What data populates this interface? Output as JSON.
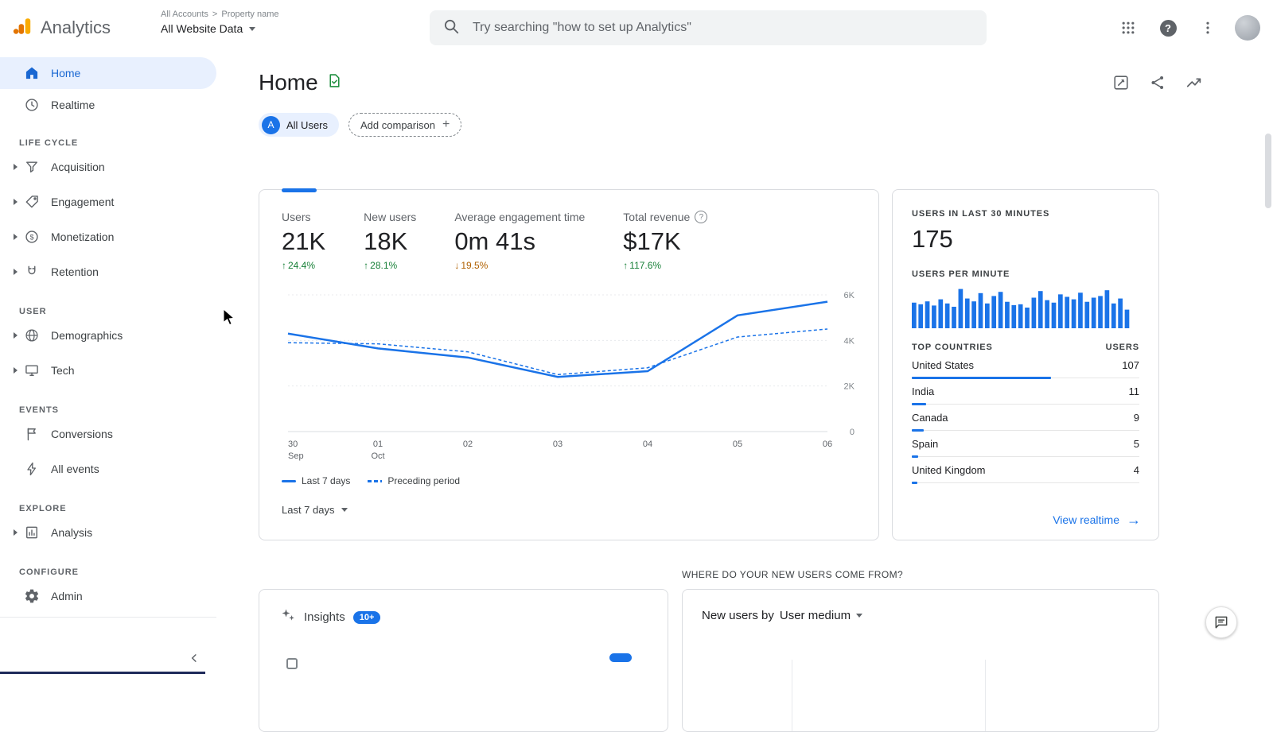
{
  "colors": {
    "accent_blue": "#1a73e8",
    "active_nav_blue": "#1967d2",
    "positive_green": "#188038",
    "negative_orange": "#b06000",
    "logo_orange": "#f9ab00",
    "logo_dark_orange": "#e37400",
    "card_border": "#dadce0"
  },
  "header": {
    "product_name": "Analytics",
    "breadcrumb": {
      "all_accounts": "All Accounts",
      "separator": ">",
      "property_name": "Property name"
    },
    "property_selector": "All Website Data",
    "search_placeholder": "Try searching \"how to set up Analytics\""
  },
  "sidebar": {
    "home": "Home",
    "realtime": "Realtime",
    "sections": {
      "life_cycle": {
        "title": "LIFE CYCLE",
        "items": [
          "Acquisition",
          "Engagement",
          "Monetization",
          "Retention"
        ]
      },
      "user": {
        "title": "USER",
        "items": [
          "Demographics",
          "Tech"
        ]
      },
      "events": {
        "title": "EVENTS",
        "items": [
          "Conversions",
          "All events"
        ]
      },
      "explore": {
        "title": "EXPLORE",
        "items": [
          "Analysis"
        ]
      },
      "configure": {
        "title": "CONFIGURE",
        "items": [
          "Admin"
        ]
      }
    }
  },
  "page": {
    "title": "Home",
    "all_users_chip": {
      "avatar": "A",
      "label": "All Users"
    },
    "add_comparison_label": "Add comparison",
    "date_range_selector": "Last 7 days"
  },
  "metrics": [
    {
      "label": "Users",
      "value": "21K",
      "delta": "24.4%",
      "direction": "up"
    },
    {
      "label": "New users",
      "value": "18K",
      "delta": "28.1%",
      "direction": "up"
    },
    {
      "label": "Average engagement time",
      "value": "0m 41s",
      "delta": "19.5%",
      "direction": "down"
    },
    {
      "label": "Total revenue",
      "value": "$17K",
      "delta": "117.6%",
      "direction": "up"
    }
  ],
  "chart_data": [
    {
      "type": "line",
      "title": "Users over time (Home overview)",
      "x": [
        "30",
        "01",
        "02",
        "03",
        "04",
        "05",
        "06"
      ],
      "x_sub": [
        "Sep",
        "Oct",
        "",
        "",
        "",
        "",
        ""
      ],
      "series": [
        {
          "name": "Last 7 days",
          "style": "solid",
          "values": [
            4300,
            3650,
            3250,
            2400,
            2650,
            5100,
            5700
          ]
        },
        {
          "name": "Preceding period",
          "style": "dashed",
          "values": [
            3900,
            3850,
            3500,
            2500,
            2800,
            4150,
            4500
          ]
        }
      ],
      "ylim": [
        0,
        6000
      ],
      "yticks": [
        0,
        2000,
        4000,
        6000
      ],
      "ytick_labels": [
        "0",
        "2K",
        "4K",
        "6K"
      ],
      "legend_position": "bottom",
      "grid": true
    },
    {
      "type": "bar",
      "title": "Users per minute",
      "values": [
        62,
        58,
        65,
        55,
        70,
        60,
        52,
        95,
        72,
        65,
        85,
        60,
        78,
        88,
        64,
        56,
        58,
        50,
        74,
        90,
        68,
        62,
        82,
        76,
        70,
        86,
        64,
        74,
        78,
        92,
        60,
        72,
        45
      ],
      "ylim": [
        0,
        100
      ]
    }
  ],
  "realtime": {
    "users_30min_label": "USERS IN LAST 30 MINUTES",
    "users_30min": "175",
    "per_minute_label": "USERS PER MINUTE",
    "top_countries_label": "TOP COUNTRIES",
    "users_col_label": "USERS",
    "countries": [
      {
        "name": "United States",
        "users": 107
      },
      {
        "name": "India",
        "users": 11
      },
      {
        "name": "Canada",
        "users": 9
      },
      {
        "name": "Spain",
        "users": 5
      },
      {
        "name": "United Kingdom",
        "users": 4
      }
    ],
    "view_realtime_label": "View realtime"
  },
  "insights_card": {
    "title": "Insights",
    "badge": "10+"
  },
  "new_users_card": {
    "question": "WHERE DO YOUR NEW USERS COME FROM?",
    "selector_prefix": "New users by",
    "selector_value": "User medium"
  }
}
